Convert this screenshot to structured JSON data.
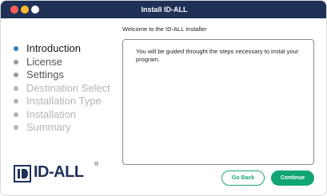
{
  "window": {
    "title": "Install ID-ALL"
  },
  "welcome": "Welcome to the ID-ALL Installer",
  "steps": [
    {
      "label": "Introduction",
      "state": "active"
    },
    {
      "label": "License",
      "state": "done"
    },
    {
      "label": "Settings",
      "state": "done"
    },
    {
      "label": "Destination Select",
      "state": "pending"
    },
    {
      "label": "Installation Type",
      "state": "pending"
    },
    {
      "label": "Installation",
      "state": "pending"
    },
    {
      "label": "Summary",
      "state": "pending"
    }
  ],
  "content": {
    "text": "You will be guided throught the steps necessary to instal your program."
  },
  "logo": {
    "text": "ID-ALL",
    "registered": "®"
  },
  "buttons": {
    "back": "Go Back",
    "continue": "Continue"
  },
  "colors": {
    "titlebar": "#1f3157",
    "accent": "#11a575",
    "active_dot": "#3178c6"
  },
  "icons": [
    "close-window-icon",
    "minimize-window-icon",
    "maximize-window-icon",
    "id-all-logo-mark-icon"
  ]
}
